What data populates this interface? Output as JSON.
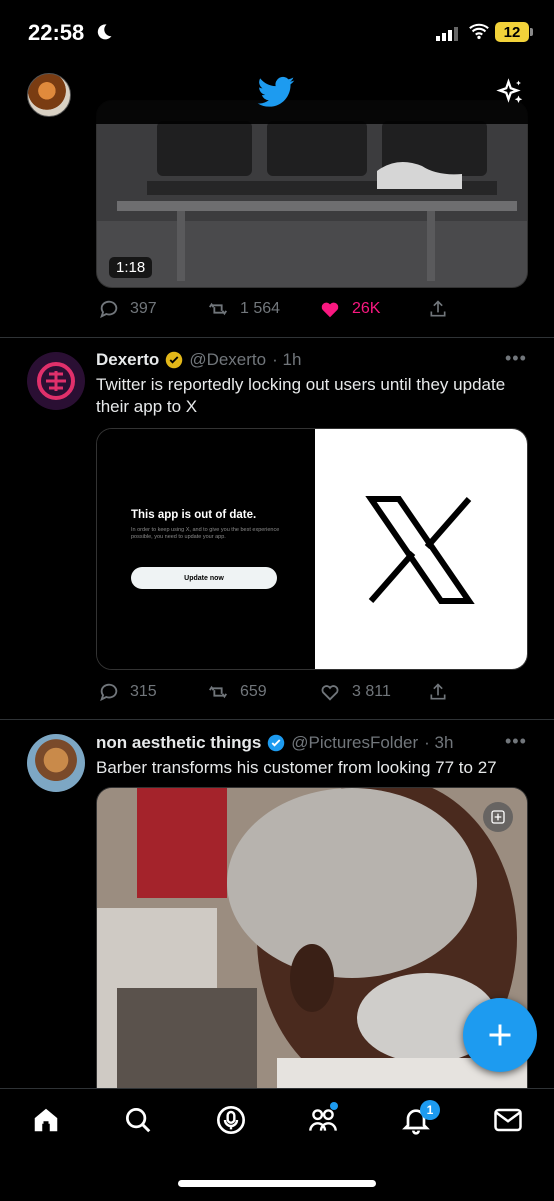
{
  "status_bar": {
    "time": "22:58",
    "battery": "12"
  },
  "tweet1": {
    "video_duration": "1:18",
    "replies": "397",
    "retweets": "1 564",
    "likes": "26K"
  },
  "tweet2": {
    "name": "Dexerto",
    "handle": "@Dexerto",
    "time": "· 1h",
    "text": "Twitter is reportedly locking out users until they update their app to X",
    "card": {
      "title": "This app is out of date.",
      "desc": "In order to keep using X, and to give you the best experience possible, you need to update your app.",
      "button": "Update now"
    },
    "replies": "315",
    "retweets": "659",
    "likes": "3 811"
  },
  "tweet3": {
    "name": "non aesthetic things",
    "handle": "@PicturesFolder",
    "time": "· 3h",
    "text": "Barber transforms his customer from looking 77 to 27"
  },
  "bottom_nav": {
    "notifications_badge": "1"
  },
  "colors": {
    "accent": "#1d9bf0",
    "like": "#f91880",
    "verified_gold": "#e2b719"
  }
}
